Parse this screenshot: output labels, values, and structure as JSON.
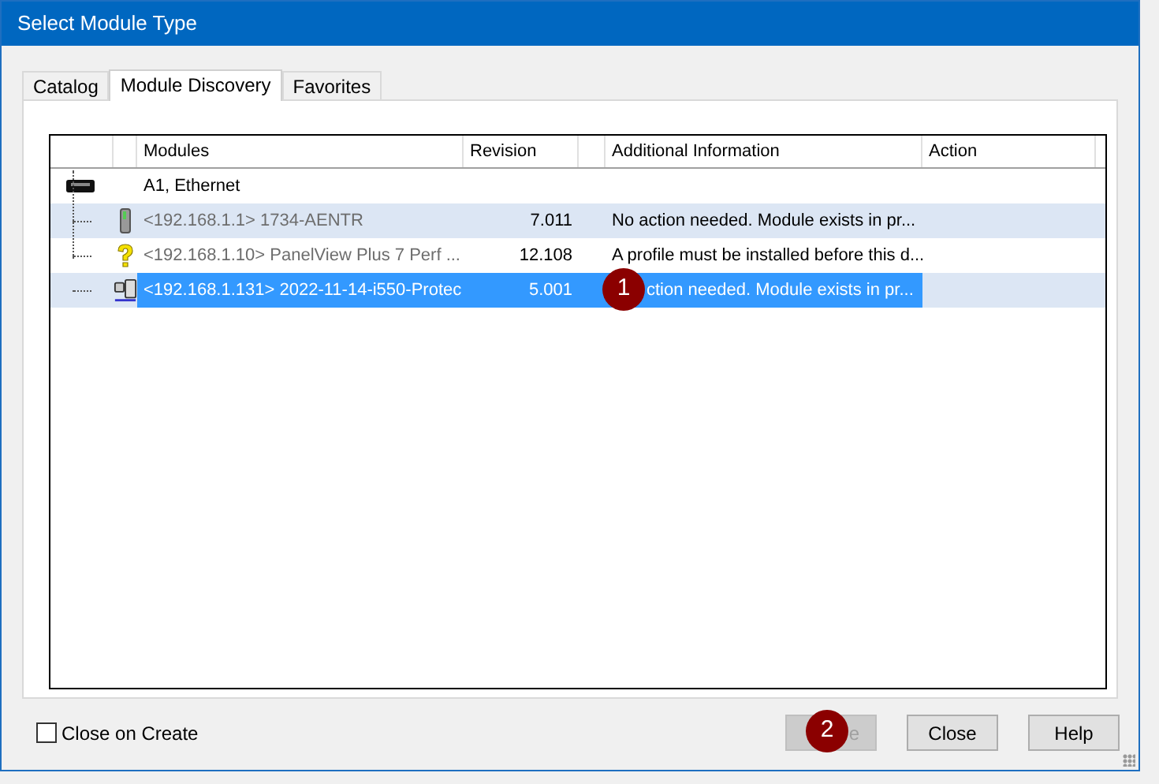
{
  "window": {
    "title": "Select Module Type"
  },
  "tabs": [
    {
      "label": "Catalog",
      "selected": false
    },
    {
      "label": "Module Discovery",
      "selected": true
    },
    {
      "label": "Favorites",
      "selected": false
    }
  ],
  "table": {
    "columns": [
      "Modules",
      "Revision",
      "Additional Information",
      "Action"
    ],
    "tree": [
      {
        "name": "A1, Ethernet",
        "kind": "network",
        "children": [
          {
            "name": "<192.168.1.1> 1734-AENTR",
            "revision": "7.011",
            "info": "No action needed.  Module exists in pr...",
            "kind": "module",
            "selected": false
          },
          {
            "name": "<192.168.1.10> PanelView Plus 7 Perf ...",
            "revision": "12.108",
            "info": "A profile must be installed before this d...",
            "kind": "unknown",
            "selected": false
          },
          {
            "name": "<192.168.1.131> 2022-11-14-i550-Protec",
            "revision": "5.001",
            "info": "ction needed.  Module exists in pr...",
            "kind": "drive",
            "selected": true,
            "callout": "1"
          }
        ]
      }
    ]
  },
  "close_on_create": {
    "label": "Close on Create",
    "checked": false
  },
  "buttons": [
    {
      "label": "e",
      "disabled": true,
      "callout": "2"
    },
    {
      "label": "Close",
      "disabled": false
    },
    {
      "label": "Help",
      "disabled": false
    }
  ]
}
